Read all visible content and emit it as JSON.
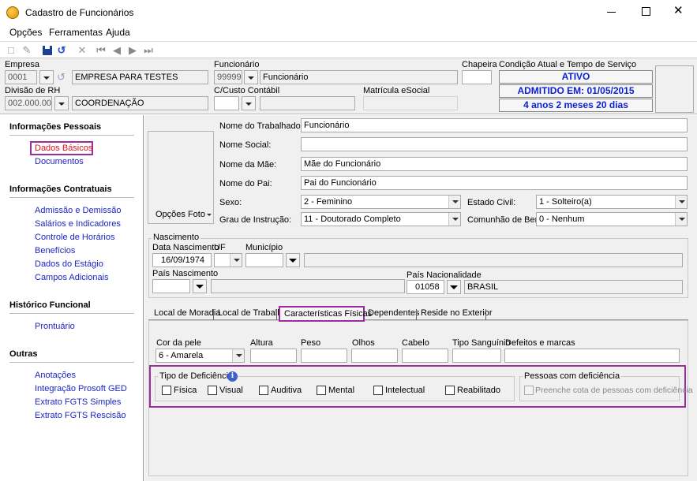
{
  "window": {
    "title": "Cadastro de Funcionários"
  },
  "menu": [
    "Opções",
    "Ferramentas",
    "Ajuda"
  ],
  "header": {
    "empresa_label": "Empresa",
    "empresa_code": "0001",
    "empresa_name": "EMPRESA PARA TESTES",
    "funcionario_label": "Funcionário",
    "funcionario_code": "99999",
    "funcionario_name": "Funcionário",
    "chapeira_label": "Chapeira",
    "chapeira_value": "",
    "condicao_label": "Condição Atual e Tempo de Serviço",
    "status": "ATIVO",
    "admitido": "ADMITIDO EM: 01/05/2015",
    "tempo": "4 anos 2 meses 20 dias",
    "divisao_label": "Divisão de RH",
    "divisao_code": "002.000.000",
    "divisao_name": "COORDENAÇÃO",
    "custo_label": "C/Custo Contábil",
    "matricula_label": "Matrícula eSocial"
  },
  "sidebar": {
    "sections": [
      {
        "title": "Informações Pessoais",
        "items": [
          "Dados Básicos",
          "Documentos"
        ]
      },
      {
        "title": "Informações Contratuais",
        "items": [
          "Admissão e Demissão",
          "Salários e Indicadores",
          "Controle de Horários",
          "Benefícios",
          "Dados do Estágio",
          "Campos Adicionais"
        ]
      },
      {
        "title": "Histórico Funcional",
        "items": [
          "Prontuário"
        ]
      },
      {
        "title": "Outras",
        "items": [
          "Anotações",
          "Integração Prosoft GED",
          "Extrato FGTS Simples",
          "Extrato FGTS Rescisão"
        ]
      }
    ]
  },
  "basic": {
    "foto_button": "Opções Foto",
    "nome_label": "Nome do Trabalhador:",
    "nome_value": "Funcionário",
    "social_label": "Nome Social:",
    "social_value": "",
    "mae_label": "Nome da Mãe:",
    "mae_value": "Mãe do Funcionário",
    "pai_label": "Nome do Pai:",
    "pai_value": "Pai do Funcionário",
    "sexo_label": "Sexo:",
    "sexo_value": "2 - Feminino",
    "civil_label": "Estado Civil:",
    "civil_value": "1 - Solteiro(a)",
    "instrucao_label": "Grau de Instrução:",
    "instrucao_value": "11 - Doutorado Completo",
    "comunhao_label": "Comunhão de Bens:",
    "comunhao_value": "0 - Nenhum"
  },
  "nascimento": {
    "group_title": "Nascimento",
    "data_label": "Data Nascimento",
    "data_value": "16/09/1974",
    "uf_label": "UF",
    "municipio_label": "Município",
    "pais_label": "País Nascimento",
    "nacionalidade_label": "País Nacionalidade",
    "nacionalidade_code": "01058",
    "nacionalidade_name": "BRASIL"
  },
  "tabs": [
    "Local de Moradia",
    "Local de Trabalho",
    "Características Físicas",
    "Dependentes",
    "Reside no Exterior"
  ],
  "fisicas": {
    "cor_label": "Cor da pele",
    "cor_value": "6 - Amarela",
    "altura_label": "Altura",
    "peso_label": "Peso",
    "olhos_label": "Olhos",
    "cabelo_label": "Cabelo",
    "sangue_label": "Tipo Sanguínio",
    "defeitos_label": "Defeitos e marcas"
  },
  "deficiencia": {
    "group_title": "Tipo de Deficiência",
    "options": [
      "Física",
      "Visual",
      "Auditiva",
      "Mental",
      "Intelectual",
      "Reabilitado"
    ],
    "pcd_title": "Pessoas com deficiência",
    "pcd_option": "Preenche cota de pessoas com deficiência"
  },
  "colors": {
    "accent_link": "#1b24c7",
    "highlight": "#9b2d9e",
    "selected_red": "#e0101a",
    "status_blue": "#0a1fd6"
  }
}
